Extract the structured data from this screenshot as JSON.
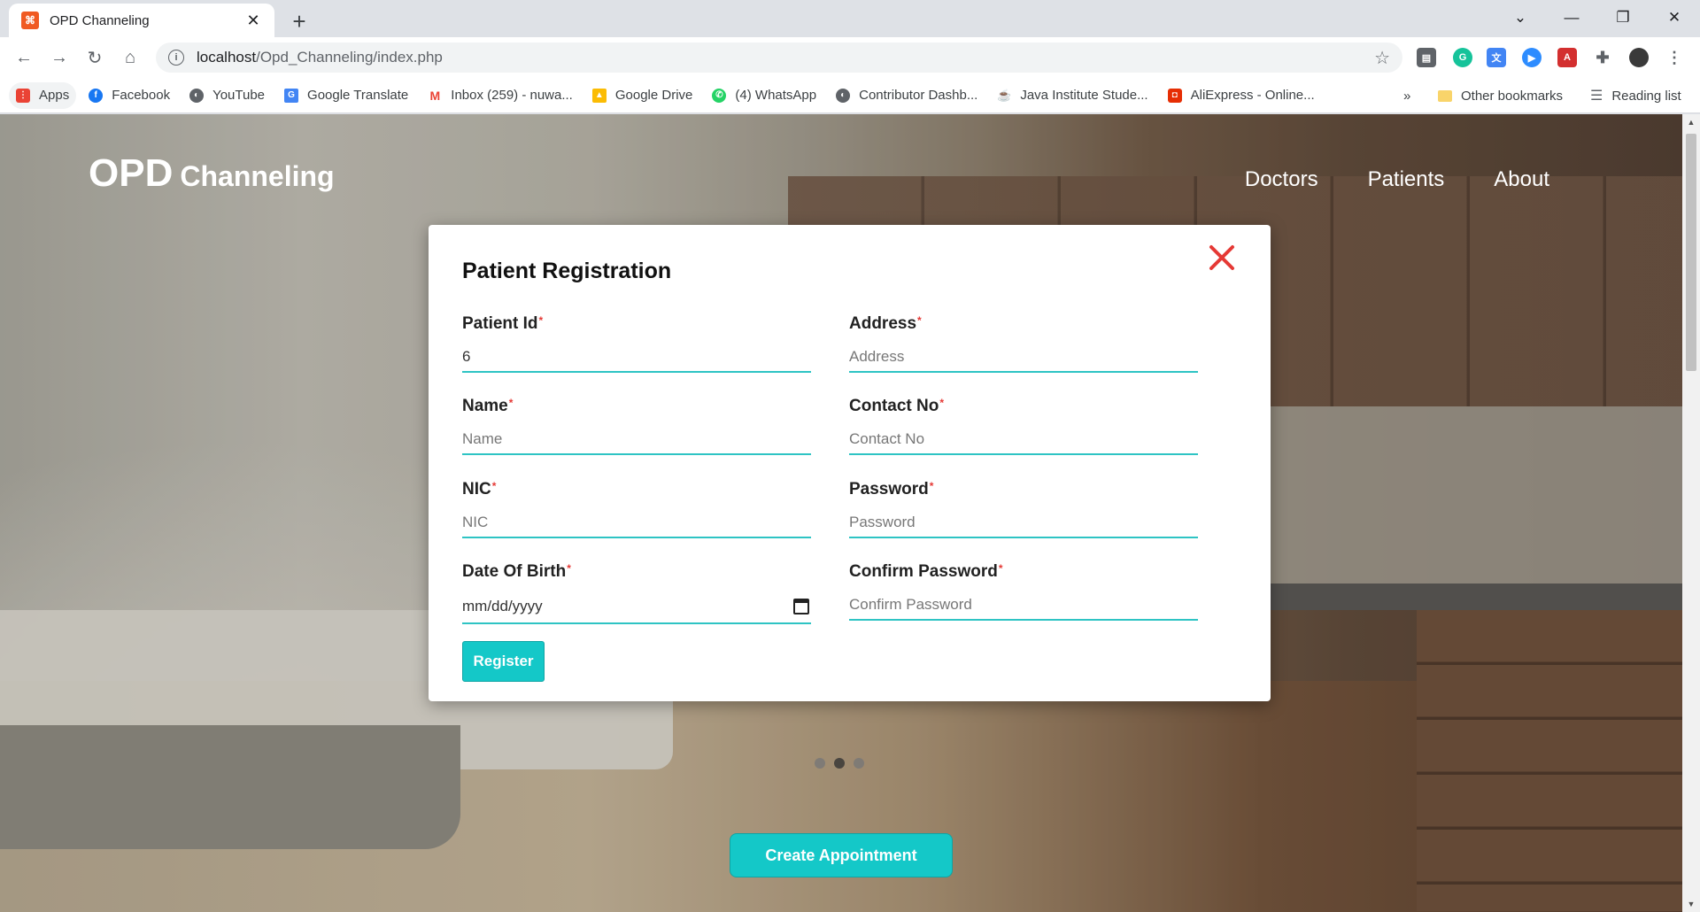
{
  "browser": {
    "tab_title": "OPD Channeling",
    "url_host": "localhost",
    "url_path": "/Opd_Channeling/index.php",
    "bookmarks": [
      {
        "label": "Apps",
        "icon": "apps-grid-icon"
      },
      {
        "label": "Facebook",
        "icon": "facebook-icon"
      },
      {
        "label": "YouTube",
        "icon": "globe-icon"
      },
      {
        "label": "Google Translate",
        "icon": "google-translate-icon"
      },
      {
        "label": "Inbox (259) - nuwa...",
        "icon": "gmail-icon"
      },
      {
        "label": "Google Drive",
        "icon": "google-drive-icon"
      },
      {
        "label": "(4) WhatsApp",
        "icon": "whatsapp-icon"
      },
      {
        "label": "Contributor Dashb...",
        "icon": "globe-icon"
      },
      {
        "label": "Java Institute Stude...",
        "icon": "java-icon"
      },
      {
        "label": "AliExpress - Online...",
        "icon": "aliexpress-icon"
      }
    ],
    "overflow": "»",
    "other_bookmarks": "Other bookmarks",
    "reading_list": "Reading list"
  },
  "site": {
    "brand_big": "OPD",
    "brand_small": "Channeling",
    "nav": [
      "Doctors",
      "Patients",
      "About"
    ]
  },
  "modal": {
    "title": "Patient Registration",
    "fields": {
      "patient_id": {
        "label": "Patient Id",
        "value": "6",
        "placeholder": ""
      },
      "address": {
        "label": "Address",
        "value": "",
        "placeholder": "Address"
      },
      "name": {
        "label": "Name",
        "value": "",
        "placeholder": "Name"
      },
      "contact": {
        "label": "Contact No",
        "value": "",
        "placeholder": "Contact No"
      },
      "nic": {
        "label": "NIC",
        "value": "",
        "placeholder": "NIC"
      },
      "password": {
        "label": "Password",
        "value": "",
        "placeholder": "Password"
      },
      "dob": {
        "label": "Date Of Birth",
        "value": "mm/dd/yyyy"
      },
      "confirm_password": {
        "label": "Confirm Password",
        "value": "",
        "placeholder": "Confirm Password"
      }
    },
    "required_mark": "*",
    "register_label": "Register"
  },
  "carousel": {
    "active_index": 1,
    "count": 3
  },
  "cta_label": "Create Appointment",
  "colors": {
    "accent": "#14c8c8",
    "close": "#e53935"
  }
}
